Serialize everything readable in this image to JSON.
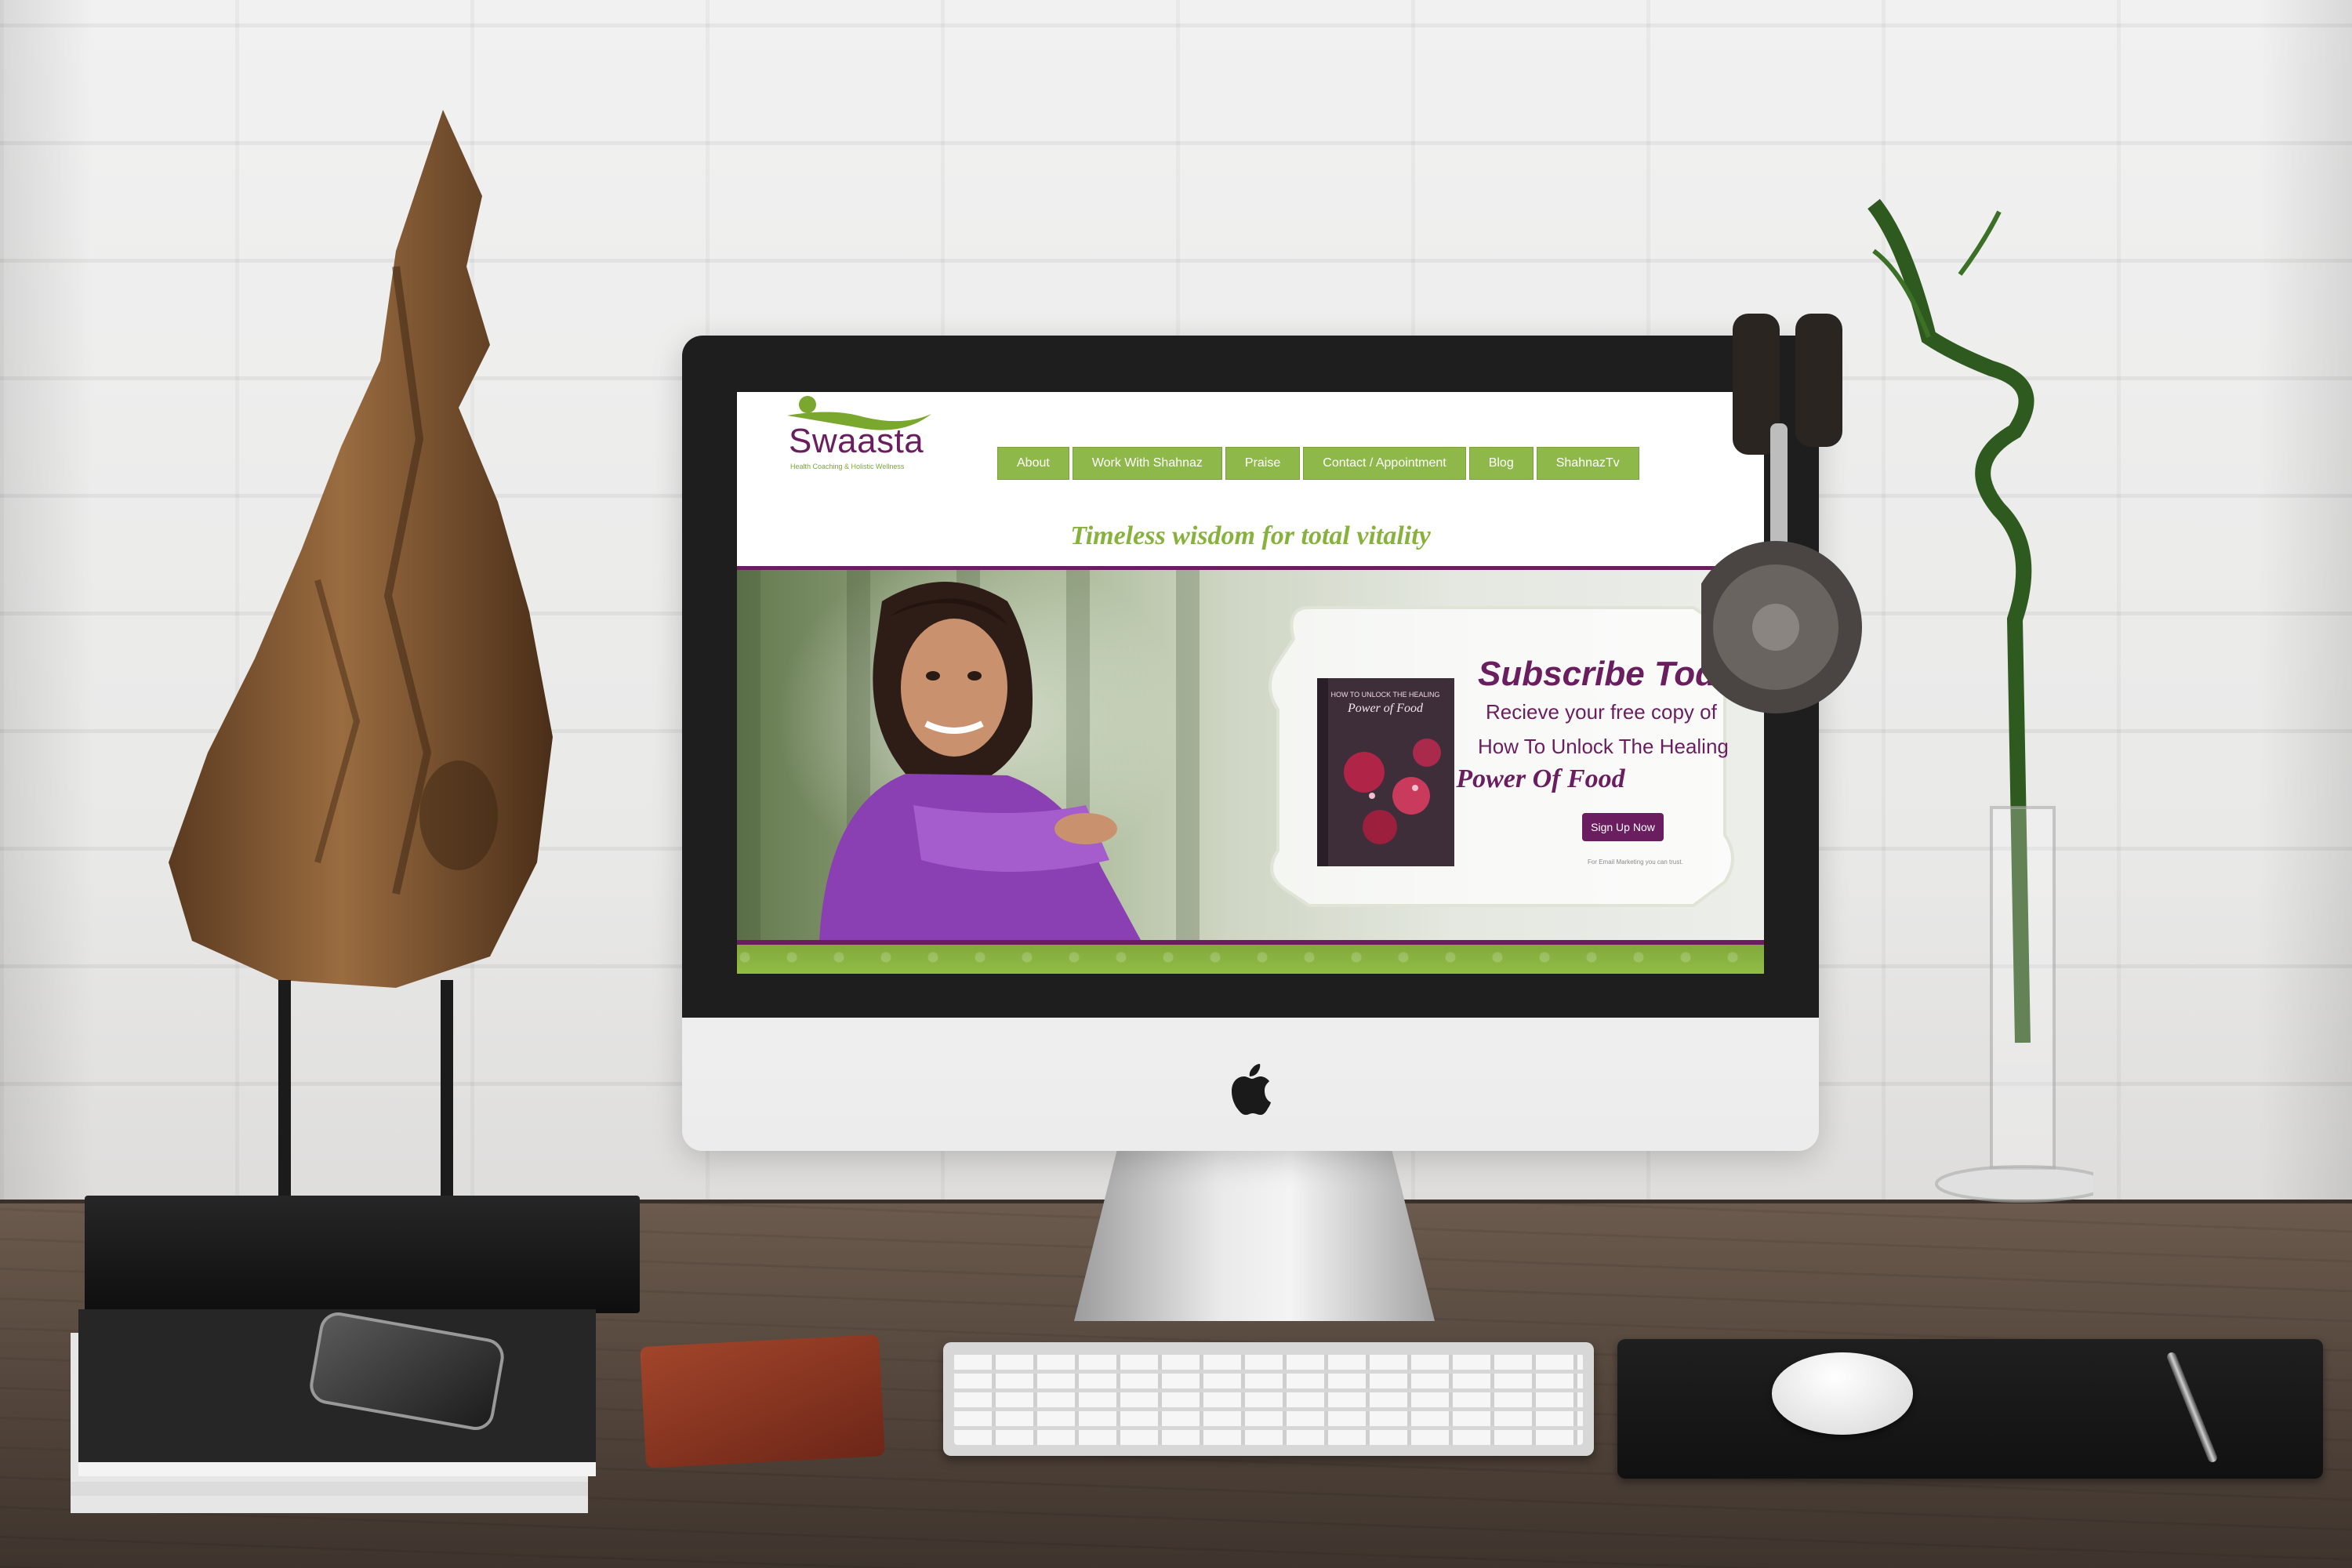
{
  "site": {
    "logo": {
      "word": "Swaasta",
      "tagline": "Health Coaching & Holistic Wellness"
    },
    "nav": [
      {
        "label": "About"
      },
      {
        "label": "Work With Shahnaz"
      },
      {
        "label": "Praise"
      },
      {
        "label": "Contact / Appointment"
      },
      {
        "label": "Blog"
      },
      {
        "label": "ShahnazTv"
      }
    ],
    "tagline": "Timeless wisdom for total vitality",
    "subscribe": {
      "title": "Subscribe Toda",
      "line1": "Recieve your free copy of",
      "line2": "How To Unlock The Healing",
      "line3": "Power Of Food",
      "button": "Sign Up Now",
      "fineprint": "For Email Marketing you can trust."
    },
    "book": {
      "top": "HOW TO UNLOCK THE HEALING",
      "main": "Power of Food"
    }
  },
  "colors": {
    "brand_purple": "#6b1e5f",
    "brand_green": "#8fb84a"
  },
  "icons": [
    "apple-logo-icon"
  ]
}
